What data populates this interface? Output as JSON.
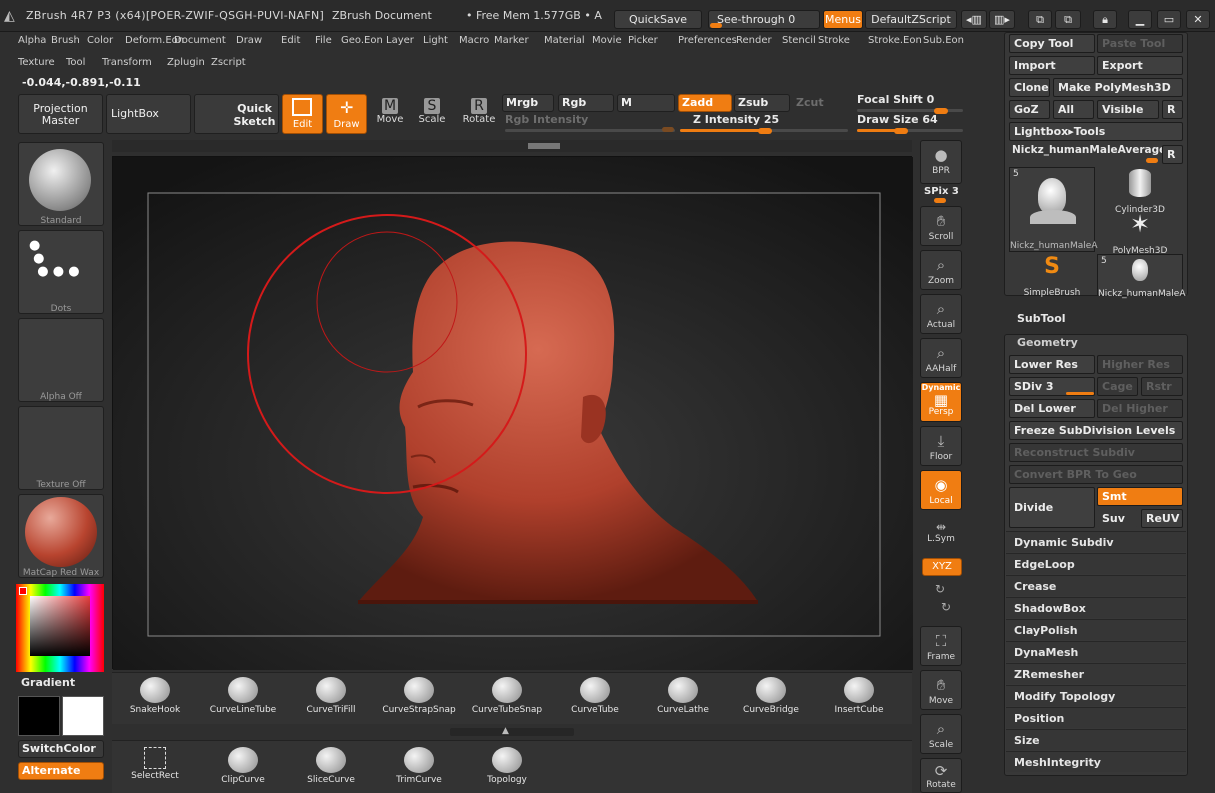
{
  "title_bar": {
    "app_title": "ZBrush 4R7 P3 (x64)[POER-ZWIF-QSGH-PUVI-NAFN]",
    "document": "ZBrush Document",
    "memory": "• Free Mem 1.577GB • A",
    "quicksave": "QuickSave",
    "see_through": "See-through  0",
    "menus": "Menus",
    "default_zscript": "DefaultZScript"
  },
  "menu_row1": [
    "Alpha",
    "Brush",
    "Color",
    "Deform.Eon",
    "Document",
    "Draw",
    "Edit",
    "File",
    "Geo.Eon",
    "Layer",
    "Light",
    "Macro",
    "Marker",
    "Material",
    "Movie",
    "Picker",
    "Preferences",
    "Render",
    "Stencil",
    "Stroke",
    "Stroke.Eon",
    "Sub.Eon"
  ],
  "menu_row2": [
    "Texture",
    "Tool",
    "Transform",
    "Zplugin",
    "Zscript"
  ],
  "coords": "-0.044,-0.891,-0.11",
  "toolbar": {
    "projection_master": "Projection Master",
    "lightbox": "LightBox",
    "quick_sketch": "Quick Sketch",
    "edit": "Edit",
    "draw": "Draw",
    "move": "Move",
    "scale": "Scale",
    "rotate": "Rotate",
    "mrgb": "Mrgb",
    "rgb": "Rgb",
    "m": "M",
    "rgb_intensity": "Rgb Intensity",
    "zadd": "Zadd",
    "zsub": "Zsub",
    "zcut": "Zcut",
    "z_intensity": "Z Intensity 25",
    "focal_shift": "Focal Shift 0",
    "draw_size": "Draw Size 64"
  },
  "left_panel": {
    "brush": "Standard",
    "stroke": "Dots",
    "alpha": "Alpha Off",
    "texture": "Texture Off",
    "material": "MatCap Red Wax",
    "gradient": "Gradient",
    "switch_color": "SwitchColor",
    "alternate": "Alternate"
  },
  "right_tools": {
    "bpr": "BPR",
    "spix": "SPix 3",
    "scroll": "Scroll",
    "zoom": "Zoom",
    "actual": "Actual",
    "aahalf": "AAHalf",
    "dynamic": "Dynamic",
    "persp": "Persp",
    "floor": "Floor",
    "local": "Local",
    "lsym": "L.Sym",
    "xyz": "XYZ",
    "frame": "Frame",
    "move": "Move",
    "scale": "Scale",
    "rotate": "Rotate"
  },
  "tool_palette": {
    "copy_tool": "Copy Tool",
    "paste_tool": "Paste Tool",
    "import": "Import",
    "export": "Export",
    "clone": "Clone",
    "make_polymesh": "Make PolyMesh3D",
    "goz": "GoZ",
    "all": "All",
    "visible": "Visible",
    "r": "R",
    "lightbox_tools": "Lightbox▸Tools",
    "current_tool": "Nickz_humanMaleAverage",
    "r2": "R",
    "thumbs": [
      {
        "name": "Nickz_humanMaleA",
        "count": "5"
      },
      {
        "name": "Cylinder3D",
        "count": ""
      },
      {
        "name": "PolyMesh3D",
        "count": ""
      },
      {
        "name": "SimpleBrush",
        "count": ""
      },
      {
        "name": "Nickz_humanMaleA",
        "count": "5"
      }
    ]
  },
  "subtool": "SubTool",
  "geometry": {
    "header": "Geometry",
    "lower_res": "Lower Res",
    "higher_res": "Higher Res",
    "sdiv": "SDiv 3",
    "cage": "Cage",
    "rstr": "Rstr",
    "del_lower": "Del Lower",
    "del_higher": "Del Higher",
    "freeze": "Freeze SubDivision Levels",
    "reconstruct": "Reconstruct Subdiv",
    "convert_bpr": "Convert BPR To Geo",
    "divide": "Divide",
    "smt": "Smt",
    "suv": "Suv",
    "reuv": "ReUV"
  },
  "sections": [
    "Dynamic Subdiv",
    "EdgeLoop",
    "Crease",
    "ShadowBox",
    "ClayPolish",
    "DynaMesh",
    "ZRemesher",
    "Modify Topology",
    "Position",
    "Size",
    "MeshIntegrity"
  ],
  "brushes": [
    "SnakeHook",
    "CurveLineTube",
    "CurveTriFill",
    "CurveStrapSnap",
    "CurveTubeSnap",
    "CurveTube",
    "CurveLathe",
    "CurveBridge",
    "InsertCube"
  ],
  "strokes": [
    "SelectRect",
    "ClipCurve",
    "SliceCurve",
    "TrimCurve",
    "Topology"
  ],
  "colors": {
    "accent": "#f07d12",
    "model": "#b8442f"
  }
}
